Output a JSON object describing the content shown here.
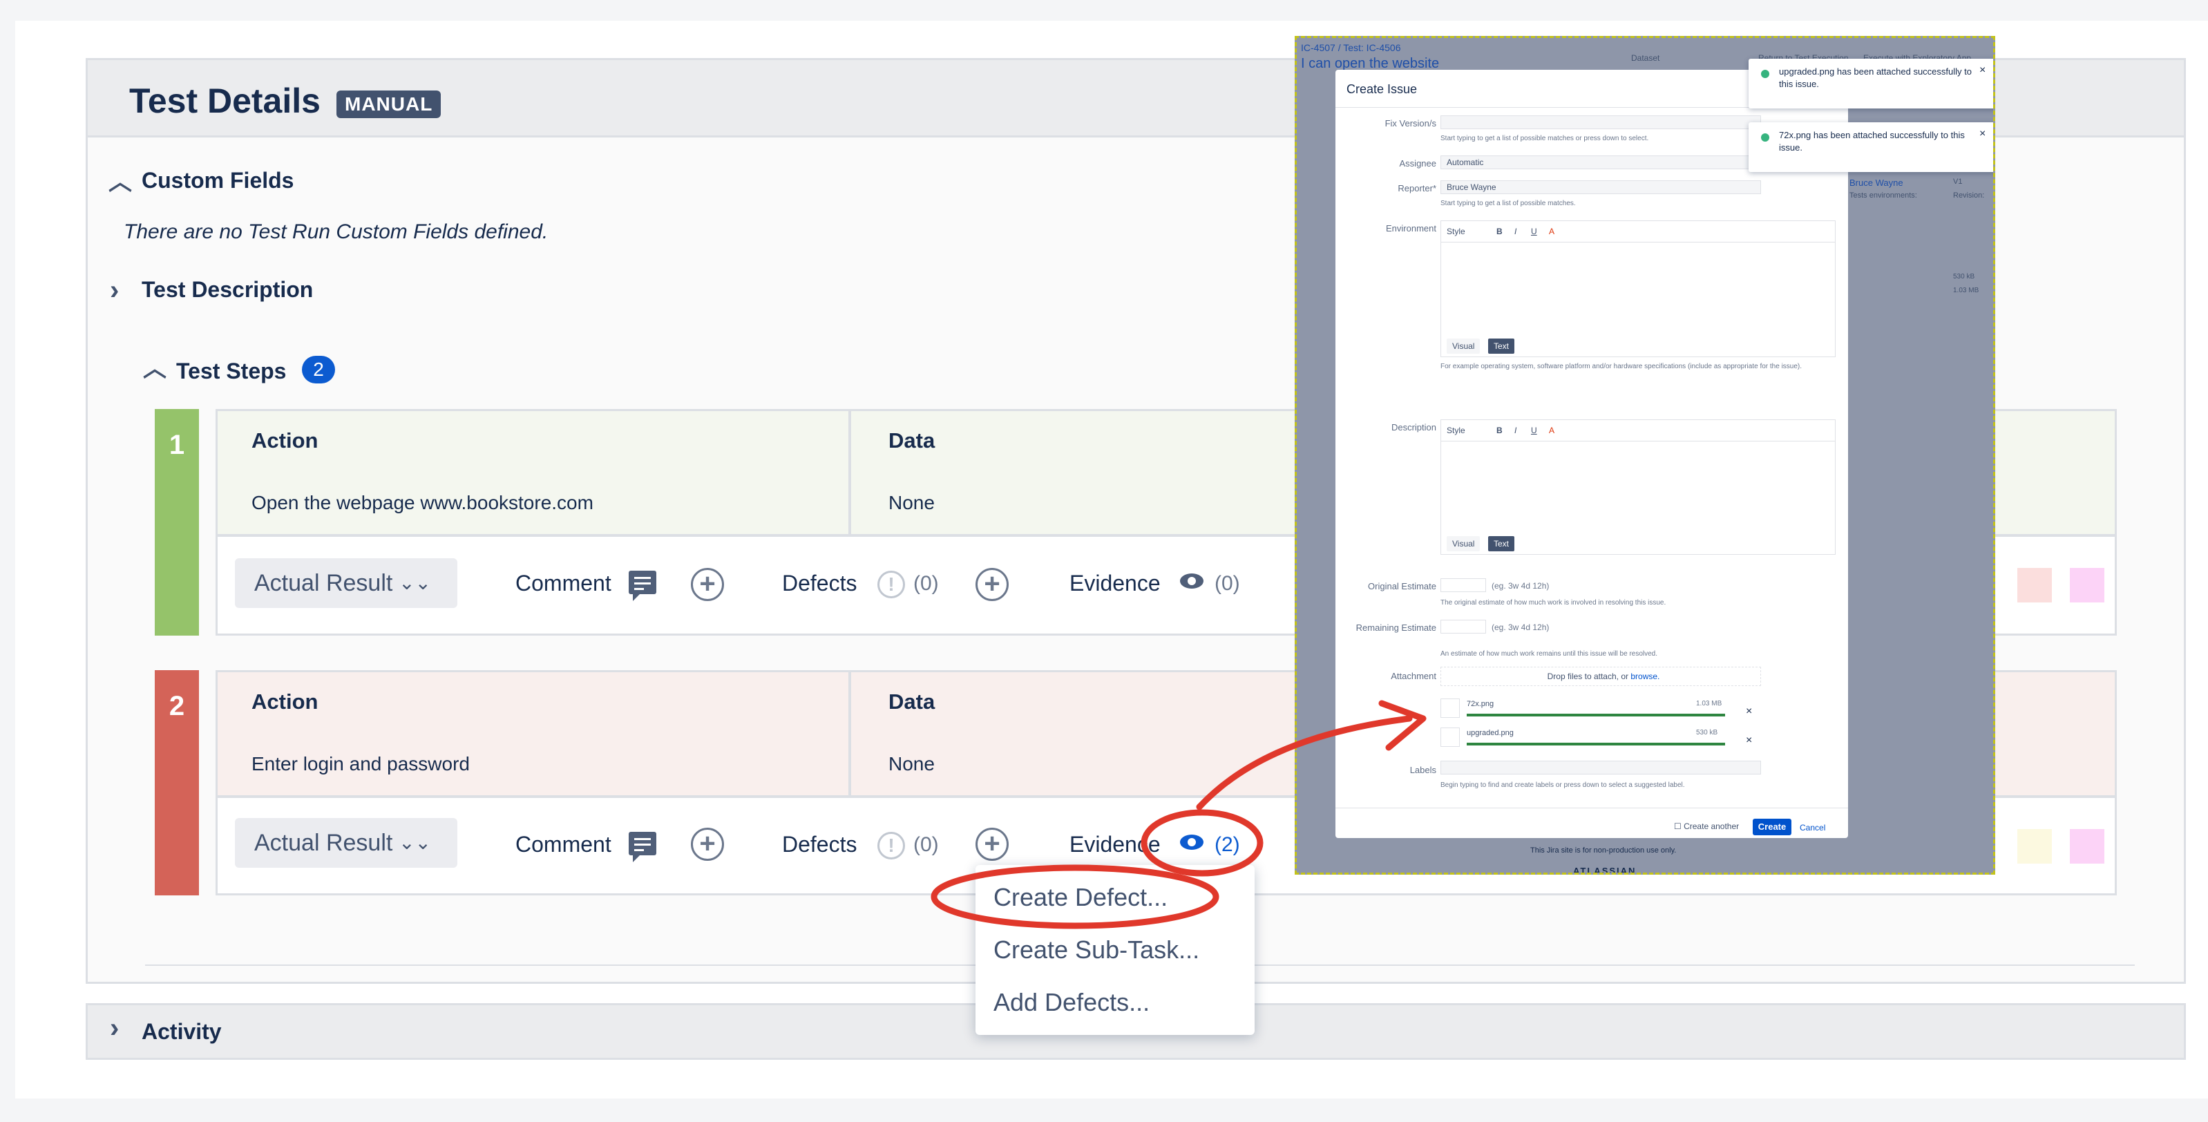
{
  "page": {
    "title": "Test Details",
    "type_badge": "MANUAL",
    "custom_fields": {
      "title": "Custom Fields",
      "empty_text": "There are no Test Run Custom Fields defined."
    },
    "test_description": {
      "title": "Test Description"
    },
    "test_steps": {
      "title": "Test Steps",
      "count": "2"
    },
    "activity": {
      "title": "Activity"
    }
  },
  "steps": [
    {
      "number": "1",
      "action_label": "Action",
      "action_text": "Open the webpage www.bookstore.com",
      "data_label": "Data",
      "data_text": "None",
      "status_color": "#95c36a",
      "bg_color": "#f4f7ef",
      "actual_result": "Actual Result",
      "comment_label": "Comment",
      "defects_label": "Defects",
      "defects_count": "(0)",
      "evidence_label": "Evidence",
      "evidence_count": "(0)"
    },
    {
      "number": "2",
      "action_label": "Action",
      "action_text": "Enter login and password",
      "data_label": "Data",
      "data_text": "None",
      "status_color": "#d46358",
      "bg_color": "#f9efed",
      "actual_result": "Actual Result",
      "comment_label": "Comment",
      "defects_label": "Defects",
      "defects_count": "(0)",
      "evidence_label": "Evidence",
      "evidence_count": "(2)"
    }
  ],
  "defect_menu": {
    "items": [
      "Create Defect...",
      "Create Sub-Task...",
      "Add Defects..."
    ]
  },
  "overlay": {
    "breadcrumb": "IC-4507  /  Test: IC-4506",
    "page_heading": "I can open the website",
    "top_buttons": [
      "Dataset",
      "Return to Test Execution",
      "Execute with Exploratory App"
    ],
    "dialog": {
      "title": "Create Issue",
      "fix_version_label": "Fix Version/s",
      "fix_version_help": "Start typing to get a list of possible matches or press down to select.",
      "assignee_label": "Assignee",
      "assignee_value": "Automatic",
      "reporter_label": "Reporter*",
      "reporter_value": "Bruce Wayne",
      "reporter_help": "Start typing to get a list of possible matches.",
      "environment_label": "Environment",
      "environment_help": "For example operating system, software platform and/or hardware specifications (include as appropriate for the issue).",
      "description_label": "Description",
      "toolbar_style": "Style",
      "tab_visual": "Visual",
      "tab_text": "Text",
      "original_estimate_label": "Original Estimate",
      "original_estimate_hint": "(eg. 3w 4d 12h)",
      "original_estimate_help": "The original estimate of how much work is involved in resolving this issue.",
      "remaining_estimate_label": "Remaining Estimate",
      "remaining_estimate_hint": "(eg. 3w 4d 12h)",
      "remaining_estimate_help": "An estimate of how much work remains until this issue will be resolved.",
      "attachment_label": "Attachment",
      "attachment_drop": "Drop files to attach, or",
      "attachment_browse": "browse.",
      "files": [
        {
          "name": "72x.png",
          "size": "1.03 MB"
        },
        {
          "name": "upgraded.png",
          "size": "530 kB"
        }
      ],
      "labels_label": "Labels",
      "labels_help": "Begin typing to find and create labels or press down to select a suggested label.",
      "create_another": "Create another",
      "create_button": "Create",
      "cancel_link": "Cancel"
    },
    "toasts": [
      "upgraded.png has been attached successfully to this issue.",
      "72x.png has been attached successfully to this issue."
    ],
    "side_info": {
      "user": "Bruce Wayne",
      "revision_label": "Revision:",
      "env_label": "Tests environments:",
      "version": "V1",
      "size1": "530 kB",
      "size2": "1.03 MB"
    },
    "footer_note": "This Jira site is for non-production use only.",
    "footer_brand": "ATLASSIAN"
  },
  "colors": {
    "annotation": "#e0382b",
    "primary": "#0052cc",
    "badge": "#42526e"
  }
}
